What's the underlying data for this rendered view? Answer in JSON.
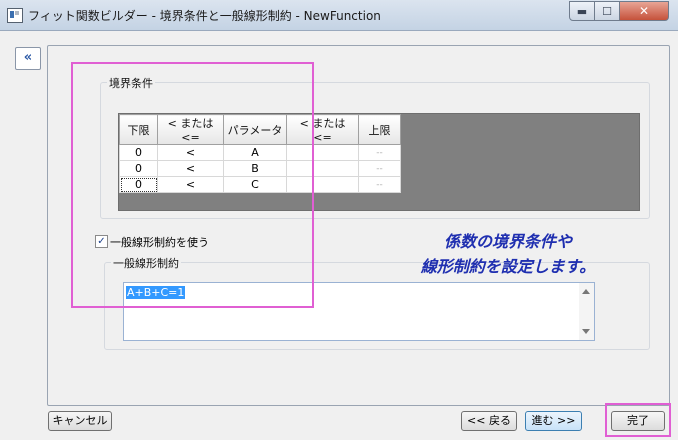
{
  "window": {
    "title": "フィット関数ビルダー - 境界条件と一般線形制約 - NewFunction",
    "minimize_glyph": "▬",
    "maximize_glyph": "☐",
    "close_glyph": "✕"
  },
  "nav": {
    "collapse_label": "«"
  },
  "bounds": {
    "group_title": "境界条件",
    "headers": [
      "下限",
      "< または <=",
      "パラメータ",
      "< または <=",
      "上限"
    ],
    "rows": [
      [
        "0",
        "<",
        "A",
        "",
        "--"
      ],
      [
        "0",
        "<",
        "B",
        "",
        "--"
      ],
      [
        "0",
        "<",
        "C",
        "",
        "--"
      ]
    ]
  },
  "linear": {
    "use_label": "一般線形制約を使う",
    "use_checked": true,
    "group_title": "一般線形制約",
    "constraint_text": "A+B+C=1"
  },
  "annotation": {
    "line1": "係数の境界条件や",
    "line2": "線形制約を設定します。"
  },
  "buttons": {
    "cancel": "キャンセル",
    "back": "<< 戻る",
    "next": "進む >>",
    "finish": "完了"
  },
  "colors": {
    "highlight": "#e05fd3",
    "annotation": "#1f2fb0",
    "selection": "#3399ff"
  }
}
